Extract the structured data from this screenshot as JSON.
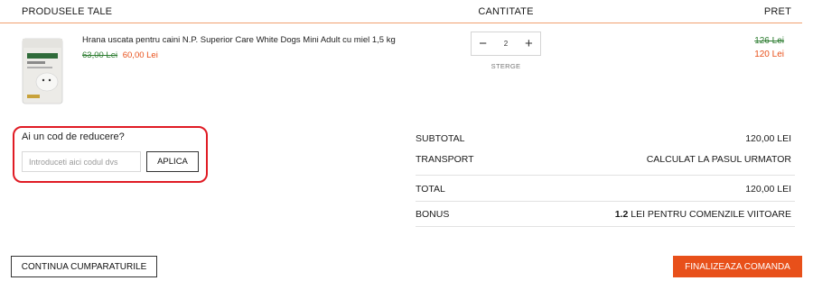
{
  "header": {
    "products": "PRODUSELE TALE",
    "quantity": "CANTITATE",
    "price": "PRET"
  },
  "product": {
    "name": "Hrana uscata pentru caini N.P. Superior Care White Dogs Mini Adult cu miel 1,5 kg",
    "old_unit_price": "63,00 Lei",
    "new_unit_price": "60,00 Lei",
    "quantity": "2",
    "decrement": "−",
    "increment": "+",
    "remove": "STERGE",
    "old_total": "126 Lei",
    "new_total": "120 Lei"
  },
  "coupon": {
    "title": "Ai un cod de reducere?",
    "placeholder": "Introduceti aici codul dvs",
    "value": "",
    "apply": "APLICA"
  },
  "summary": {
    "subtotal_label": "SUBTOTAL",
    "subtotal_value": "120,00 LEI",
    "transport_label": "TRANSPORT",
    "transport_value": "CALCULAT LA PASUL URMATOR",
    "total_label": "TOTAL",
    "total_value": "120,00 LEI",
    "bonus_label": "BONUS",
    "bonus_amount": "1.2",
    "bonus_text": " LEI PENTRU COMENZILE VIITOARE"
  },
  "actions": {
    "continue": "CONTINUA CUMPARATURILE",
    "checkout": "FINALIZEAZA COMANDA"
  },
  "colors": {
    "accent": "#e8501a",
    "old_price_green": "#2e7d32",
    "highlight_red": "#e01b24"
  }
}
